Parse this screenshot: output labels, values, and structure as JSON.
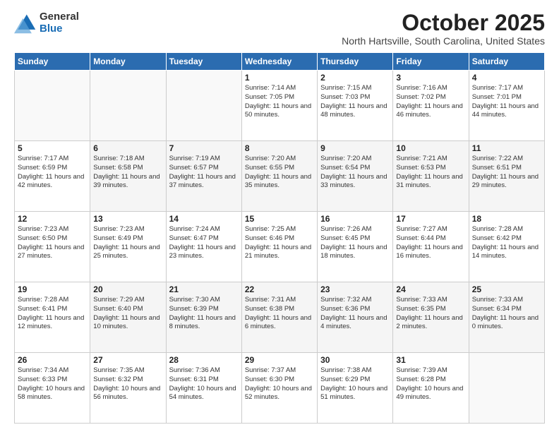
{
  "logo": {
    "general": "General",
    "blue": "Blue"
  },
  "title": "October 2025",
  "location": "North Hartsville, South Carolina, United States",
  "weekdays": [
    "Sunday",
    "Monday",
    "Tuesday",
    "Wednesday",
    "Thursday",
    "Friday",
    "Saturday"
  ],
  "weeks": [
    [
      {
        "day": "",
        "info": ""
      },
      {
        "day": "",
        "info": ""
      },
      {
        "day": "",
        "info": ""
      },
      {
        "day": "1",
        "info": "Sunrise: 7:14 AM\nSunset: 7:05 PM\nDaylight: 11 hours\nand 50 minutes."
      },
      {
        "day": "2",
        "info": "Sunrise: 7:15 AM\nSunset: 7:03 PM\nDaylight: 11 hours\nand 48 minutes."
      },
      {
        "day": "3",
        "info": "Sunrise: 7:16 AM\nSunset: 7:02 PM\nDaylight: 11 hours\nand 46 minutes."
      },
      {
        "day": "4",
        "info": "Sunrise: 7:17 AM\nSunset: 7:01 PM\nDaylight: 11 hours\nand 44 minutes."
      }
    ],
    [
      {
        "day": "5",
        "info": "Sunrise: 7:17 AM\nSunset: 6:59 PM\nDaylight: 11 hours\nand 42 minutes."
      },
      {
        "day": "6",
        "info": "Sunrise: 7:18 AM\nSunset: 6:58 PM\nDaylight: 11 hours\nand 39 minutes."
      },
      {
        "day": "7",
        "info": "Sunrise: 7:19 AM\nSunset: 6:57 PM\nDaylight: 11 hours\nand 37 minutes."
      },
      {
        "day": "8",
        "info": "Sunrise: 7:20 AM\nSunset: 6:55 PM\nDaylight: 11 hours\nand 35 minutes."
      },
      {
        "day": "9",
        "info": "Sunrise: 7:20 AM\nSunset: 6:54 PM\nDaylight: 11 hours\nand 33 minutes."
      },
      {
        "day": "10",
        "info": "Sunrise: 7:21 AM\nSunset: 6:53 PM\nDaylight: 11 hours\nand 31 minutes."
      },
      {
        "day": "11",
        "info": "Sunrise: 7:22 AM\nSunset: 6:51 PM\nDaylight: 11 hours\nand 29 minutes."
      }
    ],
    [
      {
        "day": "12",
        "info": "Sunrise: 7:23 AM\nSunset: 6:50 PM\nDaylight: 11 hours\nand 27 minutes."
      },
      {
        "day": "13",
        "info": "Sunrise: 7:23 AM\nSunset: 6:49 PM\nDaylight: 11 hours\nand 25 minutes."
      },
      {
        "day": "14",
        "info": "Sunrise: 7:24 AM\nSunset: 6:47 PM\nDaylight: 11 hours\nand 23 minutes."
      },
      {
        "day": "15",
        "info": "Sunrise: 7:25 AM\nSunset: 6:46 PM\nDaylight: 11 hours\nand 21 minutes."
      },
      {
        "day": "16",
        "info": "Sunrise: 7:26 AM\nSunset: 6:45 PM\nDaylight: 11 hours\nand 18 minutes."
      },
      {
        "day": "17",
        "info": "Sunrise: 7:27 AM\nSunset: 6:44 PM\nDaylight: 11 hours\nand 16 minutes."
      },
      {
        "day": "18",
        "info": "Sunrise: 7:28 AM\nSunset: 6:42 PM\nDaylight: 11 hours\nand 14 minutes."
      }
    ],
    [
      {
        "day": "19",
        "info": "Sunrise: 7:28 AM\nSunset: 6:41 PM\nDaylight: 11 hours\nand 12 minutes."
      },
      {
        "day": "20",
        "info": "Sunrise: 7:29 AM\nSunset: 6:40 PM\nDaylight: 11 hours\nand 10 minutes."
      },
      {
        "day": "21",
        "info": "Sunrise: 7:30 AM\nSunset: 6:39 PM\nDaylight: 11 hours\nand 8 minutes."
      },
      {
        "day": "22",
        "info": "Sunrise: 7:31 AM\nSunset: 6:38 PM\nDaylight: 11 hours\nand 6 minutes."
      },
      {
        "day": "23",
        "info": "Sunrise: 7:32 AM\nSunset: 6:36 PM\nDaylight: 11 hours\nand 4 minutes."
      },
      {
        "day": "24",
        "info": "Sunrise: 7:33 AM\nSunset: 6:35 PM\nDaylight: 11 hours\nand 2 minutes."
      },
      {
        "day": "25",
        "info": "Sunrise: 7:33 AM\nSunset: 6:34 PM\nDaylight: 11 hours\nand 0 minutes."
      }
    ],
    [
      {
        "day": "26",
        "info": "Sunrise: 7:34 AM\nSunset: 6:33 PM\nDaylight: 10 hours\nand 58 minutes."
      },
      {
        "day": "27",
        "info": "Sunrise: 7:35 AM\nSunset: 6:32 PM\nDaylight: 10 hours\nand 56 minutes."
      },
      {
        "day": "28",
        "info": "Sunrise: 7:36 AM\nSunset: 6:31 PM\nDaylight: 10 hours\nand 54 minutes."
      },
      {
        "day": "29",
        "info": "Sunrise: 7:37 AM\nSunset: 6:30 PM\nDaylight: 10 hours\nand 52 minutes."
      },
      {
        "day": "30",
        "info": "Sunrise: 7:38 AM\nSunset: 6:29 PM\nDaylight: 10 hours\nand 51 minutes."
      },
      {
        "day": "31",
        "info": "Sunrise: 7:39 AM\nSunset: 6:28 PM\nDaylight: 10 hours\nand 49 minutes."
      },
      {
        "day": "",
        "info": ""
      }
    ]
  ]
}
